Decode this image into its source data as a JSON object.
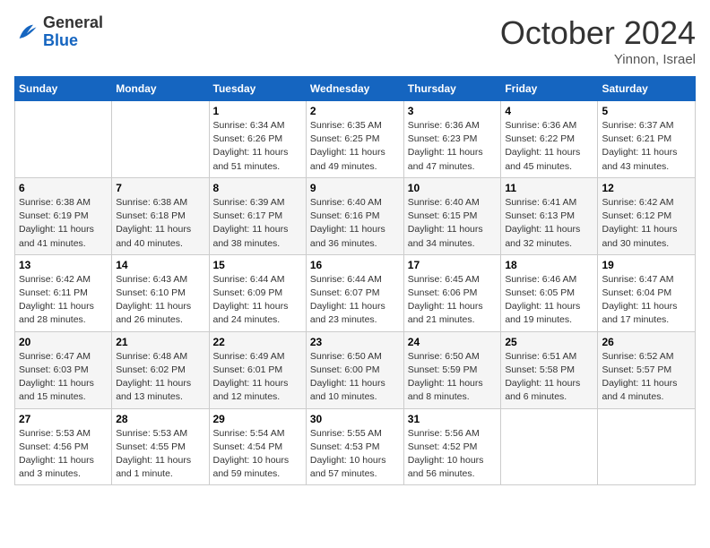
{
  "header": {
    "logo": {
      "general": "General",
      "blue": "Blue"
    },
    "month": "October 2024",
    "location": "Yinnon, Israel"
  },
  "weekdays": [
    "Sunday",
    "Monday",
    "Tuesday",
    "Wednesday",
    "Thursday",
    "Friday",
    "Saturday"
  ],
  "weeks": [
    [
      {
        "day": "",
        "info": ""
      },
      {
        "day": "",
        "info": ""
      },
      {
        "day": "1",
        "info": "Sunrise: 6:34 AM\nSunset: 6:26 PM\nDaylight: 11 hours and 51 minutes."
      },
      {
        "day": "2",
        "info": "Sunrise: 6:35 AM\nSunset: 6:25 PM\nDaylight: 11 hours and 49 minutes."
      },
      {
        "day": "3",
        "info": "Sunrise: 6:36 AM\nSunset: 6:23 PM\nDaylight: 11 hours and 47 minutes."
      },
      {
        "day": "4",
        "info": "Sunrise: 6:36 AM\nSunset: 6:22 PM\nDaylight: 11 hours and 45 minutes."
      },
      {
        "day": "5",
        "info": "Sunrise: 6:37 AM\nSunset: 6:21 PM\nDaylight: 11 hours and 43 minutes."
      }
    ],
    [
      {
        "day": "6",
        "info": "Sunrise: 6:38 AM\nSunset: 6:19 PM\nDaylight: 11 hours and 41 minutes."
      },
      {
        "day": "7",
        "info": "Sunrise: 6:38 AM\nSunset: 6:18 PM\nDaylight: 11 hours and 40 minutes."
      },
      {
        "day": "8",
        "info": "Sunrise: 6:39 AM\nSunset: 6:17 PM\nDaylight: 11 hours and 38 minutes."
      },
      {
        "day": "9",
        "info": "Sunrise: 6:40 AM\nSunset: 6:16 PM\nDaylight: 11 hours and 36 minutes."
      },
      {
        "day": "10",
        "info": "Sunrise: 6:40 AM\nSunset: 6:15 PM\nDaylight: 11 hours and 34 minutes."
      },
      {
        "day": "11",
        "info": "Sunrise: 6:41 AM\nSunset: 6:13 PM\nDaylight: 11 hours and 32 minutes."
      },
      {
        "day": "12",
        "info": "Sunrise: 6:42 AM\nSunset: 6:12 PM\nDaylight: 11 hours and 30 minutes."
      }
    ],
    [
      {
        "day": "13",
        "info": "Sunrise: 6:42 AM\nSunset: 6:11 PM\nDaylight: 11 hours and 28 minutes."
      },
      {
        "day": "14",
        "info": "Sunrise: 6:43 AM\nSunset: 6:10 PM\nDaylight: 11 hours and 26 minutes."
      },
      {
        "day": "15",
        "info": "Sunrise: 6:44 AM\nSunset: 6:09 PM\nDaylight: 11 hours and 24 minutes."
      },
      {
        "day": "16",
        "info": "Sunrise: 6:44 AM\nSunset: 6:07 PM\nDaylight: 11 hours and 23 minutes."
      },
      {
        "day": "17",
        "info": "Sunrise: 6:45 AM\nSunset: 6:06 PM\nDaylight: 11 hours and 21 minutes."
      },
      {
        "day": "18",
        "info": "Sunrise: 6:46 AM\nSunset: 6:05 PM\nDaylight: 11 hours and 19 minutes."
      },
      {
        "day": "19",
        "info": "Sunrise: 6:47 AM\nSunset: 6:04 PM\nDaylight: 11 hours and 17 minutes."
      }
    ],
    [
      {
        "day": "20",
        "info": "Sunrise: 6:47 AM\nSunset: 6:03 PM\nDaylight: 11 hours and 15 minutes."
      },
      {
        "day": "21",
        "info": "Sunrise: 6:48 AM\nSunset: 6:02 PM\nDaylight: 11 hours and 13 minutes."
      },
      {
        "day": "22",
        "info": "Sunrise: 6:49 AM\nSunset: 6:01 PM\nDaylight: 11 hours and 12 minutes."
      },
      {
        "day": "23",
        "info": "Sunrise: 6:50 AM\nSunset: 6:00 PM\nDaylight: 11 hours and 10 minutes."
      },
      {
        "day": "24",
        "info": "Sunrise: 6:50 AM\nSunset: 5:59 PM\nDaylight: 11 hours and 8 minutes."
      },
      {
        "day": "25",
        "info": "Sunrise: 6:51 AM\nSunset: 5:58 PM\nDaylight: 11 hours and 6 minutes."
      },
      {
        "day": "26",
        "info": "Sunrise: 6:52 AM\nSunset: 5:57 PM\nDaylight: 11 hours and 4 minutes."
      }
    ],
    [
      {
        "day": "27",
        "info": "Sunrise: 5:53 AM\nSunset: 4:56 PM\nDaylight: 11 hours and 3 minutes."
      },
      {
        "day": "28",
        "info": "Sunrise: 5:53 AM\nSunset: 4:55 PM\nDaylight: 11 hours and 1 minute."
      },
      {
        "day": "29",
        "info": "Sunrise: 5:54 AM\nSunset: 4:54 PM\nDaylight: 10 hours and 59 minutes."
      },
      {
        "day": "30",
        "info": "Sunrise: 5:55 AM\nSunset: 4:53 PM\nDaylight: 10 hours and 57 minutes."
      },
      {
        "day": "31",
        "info": "Sunrise: 5:56 AM\nSunset: 4:52 PM\nDaylight: 10 hours and 56 minutes."
      },
      {
        "day": "",
        "info": ""
      },
      {
        "day": "",
        "info": ""
      }
    ]
  ]
}
